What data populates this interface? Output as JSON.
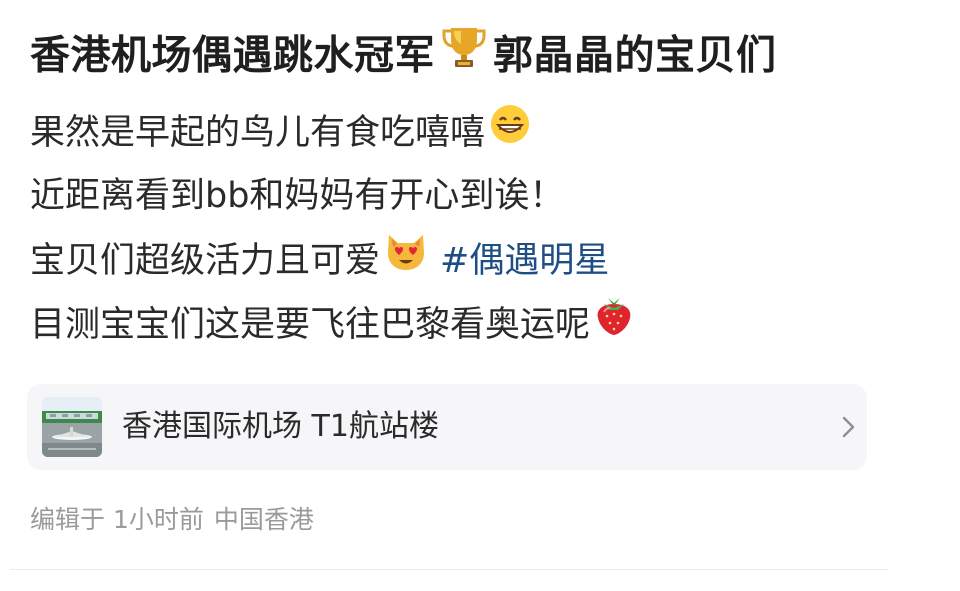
{
  "post": {
    "title_text": "香港机场偶遇跳水冠军",
    "title_icon": "trophy-icon",
    "title_suffix": "郭晶晶的宝贝们",
    "lines": [
      {
        "text": "果然是早起的鸟儿有食吃嘻嘻",
        "icon": "grinning-face-icon"
      },
      {
        "text": "近距离看到bb和妈妈有开心到诶！"
      },
      {
        "text": "宝贝们超级活力且可爱",
        "icon": "heart-eyes-cat-icon",
        "hashtag": "偶遇明星",
        "hashtag_sign": "#"
      },
      {
        "text": "目测宝宝们这是要飞往巴黎看奥运呢",
        "icon": "strawberry-icon"
      }
    ],
    "location": {
      "name": "香港国际机场 T1航站楼",
      "thumb_icon": "airport-thumbnail-icon",
      "arrow_icon": "chevron-right-icon"
    },
    "meta": {
      "edited": "编辑于",
      "time": "1小时前",
      "place": "中国香港"
    },
    "colors": {
      "text": "#2a2a2a",
      "hashtag": "#1f4e84",
      "meta": "#9a9a9a",
      "card_bg": "#f6f6f8"
    }
  }
}
